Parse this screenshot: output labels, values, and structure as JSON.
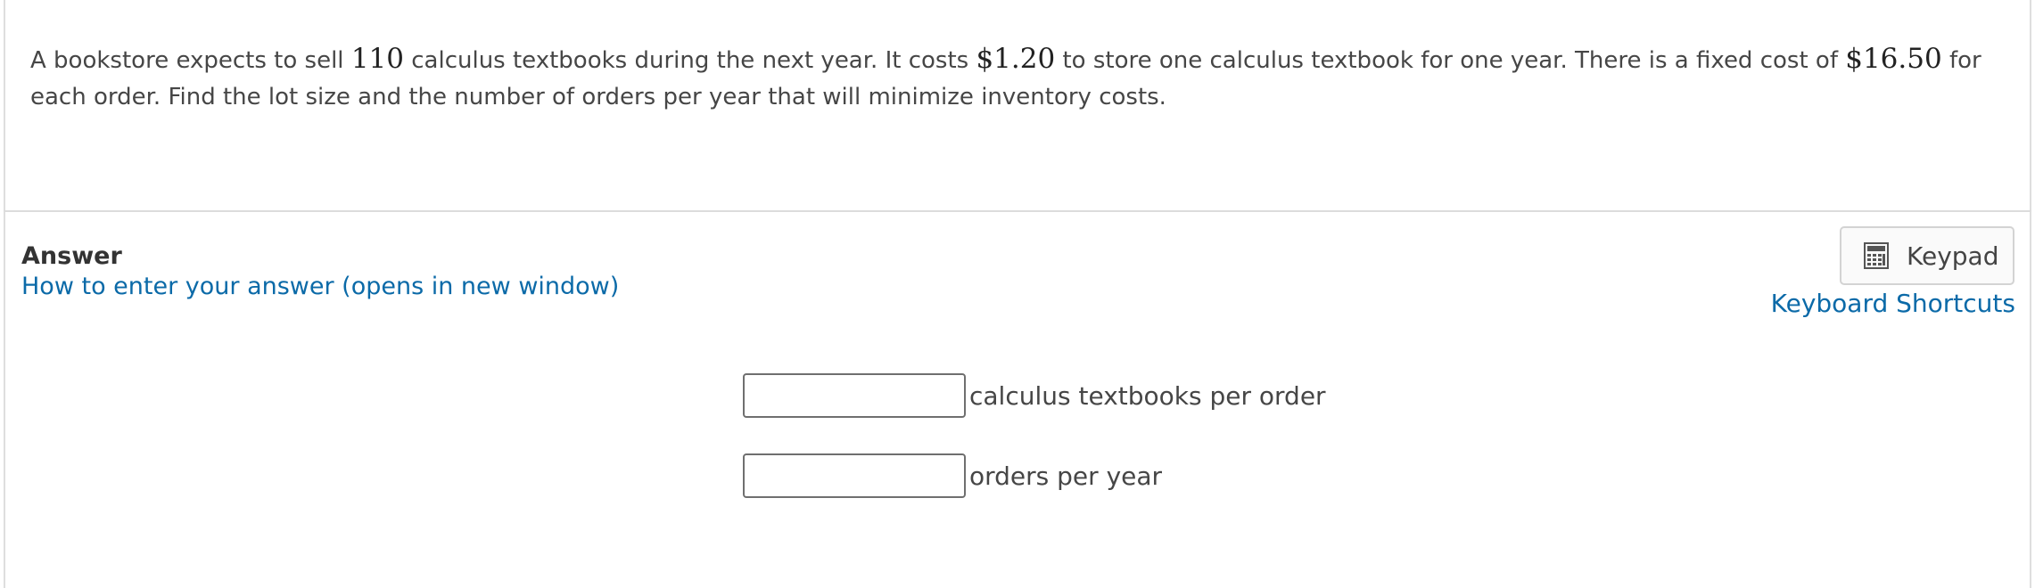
{
  "question": {
    "t1": "A bookstore expects to sell ",
    "sales": "110",
    "t2": " calculus textbooks during the next year.  It costs ",
    "storage_cost": "$1.20",
    "t3": " to store one calculus textbook for one year.  There is a fixed cost of ",
    "fixed_cost": "$16.50",
    "t4": " for each order.  Find the lot size and the number of orders per year that will minimize inventory costs."
  },
  "answer": {
    "heading": "Answer",
    "help_link": "How to enter your answer (opens in new window)",
    "keypad_label": "Keypad",
    "keypad_icon": "calculator-icon",
    "shortcuts_link": "Keyboard Shortcuts",
    "fields": [
      {
        "value": "",
        "suffix": "calculus textbooks per order"
      },
      {
        "value": "",
        "suffix": "orders per year"
      }
    ]
  },
  "colors": {
    "link": "#0b6aa8",
    "text": "#464646",
    "border": "#dcdcdc"
  }
}
